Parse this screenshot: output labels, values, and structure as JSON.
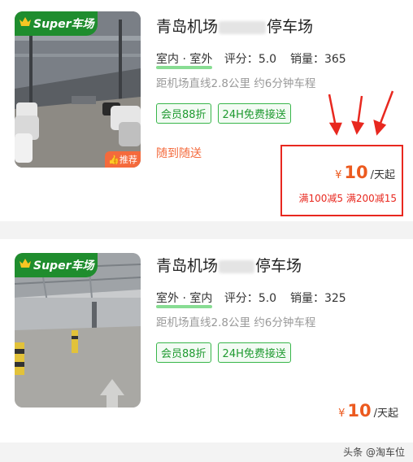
{
  "listings": [
    {
      "badge": "Super车场",
      "recommend": "推荐",
      "title_prefix": "青岛机场",
      "title_suffix": "停车场",
      "parking_type": "室内 · 室外",
      "rating_label": "评分：",
      "rating": "5.0",
      "sales_label": "销量：",
      "sales": "365",
      "distance": "距机场直线2.8公里 约6分钟车程",
      "tags": [
        "会员88折",
        "24H免费接送"
      ],
      "follow_text": "随到随送",
      "currency": "¥",
      "price": "10",
      "price_unit": "/天起",
      "discounts": "满100减5 满200减15"
    },
    {
      "badge": "Super车场",
      "title_prefix": "青岛机场",
      "title_suffix": "停车场",
      "parking_type": "室外 · 室内",
      "rating_label": "评分：",
      "rating": "5.0",
      "sales_label": "销量：",
      "sales": "325",
      "distance": "距机场直线2.8公里 约6分钟车程",
      "tags": [
        "会员88折",
        "24H免费接送"
      ],
      "currency": "¥",
      "price": "10",
      "price_unit": "/天起"
    }
  ],
  "watermark": "头条 @淘车位",
  "colors": {
    "brand_green": "#1f8d2e",
    "price_orange": "#ec5a1f",
    "highlight_red": "#e8281f",
    "tag_green": "#38b64a"
  }
}
